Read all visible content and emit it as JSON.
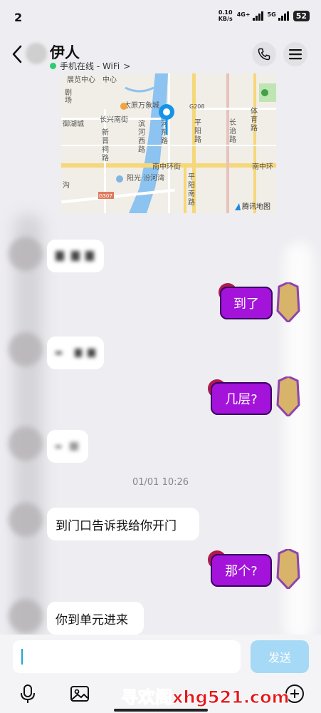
{
  "status_bar": {
    "time": "2",
    "net_speed_value": "0.10",
    "net_speed_unit": "KB/s",
    "sig1_label": "4G+",
    "sig2_label": "5G",
    "battery": "52"
  },
  "header": {
    "contact_name": "伊人",
    "presence": "手机在线 - WiFi",
    "presence_chevron": ">",
    "back_icon": "chevron-left-icon",
    "call_icon": "phone-icon",
    "menu_icon": "hamburger-menu-icon",
    "online_color": "#2ecc71"
  },
  "map": {
    "labels": {
      "l1": "展览中心",
      "l2": "剧",
      "l3": "场",
      "l4": "太原万象城",
      "l5": "御湖城",
      "l6": "长兴南街",
      "l7": "新",
      "l8": "晋",
      "l9": "祠",
      "l10": "路",
      "l11": "滨",
      "l12": "河",
      "l13": "西",
      "l14": "路",
      "l15": "河",
      "l16": "东",
      "l17": "路",
      "l18": "G208",
      "l19": "平",
      "l20": "阳",
      "l21": "路",
      "l22": "长",
      "l23": "治",
      "l24": "路",
      "l25": "体",
      "l26": "育",
      "l27": "路",
      "l28": "南中环街",
      "l29": "南中环",
      "l30": "平",
      "l31": "阳",
      "l32": "南",
      "l33": "路",
      "l34": "阳光·汾河湾",
      "l35": "G307",
      "l36": "腾讯地图",
      "l37": "沟",
      "l38": "中心"
    },
    "pin_color": "#1593e8",
    "brand_logo": "tencent-map-logo"
  },
  "messages": {
    "m1_out": "到了",
    "m2_out": "几层?",
    "timestamp": "01/01 10:26",
    "m3_in": "到门口告诉我给你开门",
    "m4_out": "那个?",
    "m5_in": "你到单元进来"
  },
  "input": {
    "value": "",
    "send_label": "发送"
  },
  "toolbar": {
    "mic_icon": "microphone-icon",
    "image_icon": "image-icon",
    "plus_icon": "plus-circle-icon"
  },
  "watermark": "寻欢阁xhg521.com",
  "colors": {
    "bubble_out": "#a313d9",
    "send_button": "#a5d9f6",
    "background": "#eeedf1"
  }
}
